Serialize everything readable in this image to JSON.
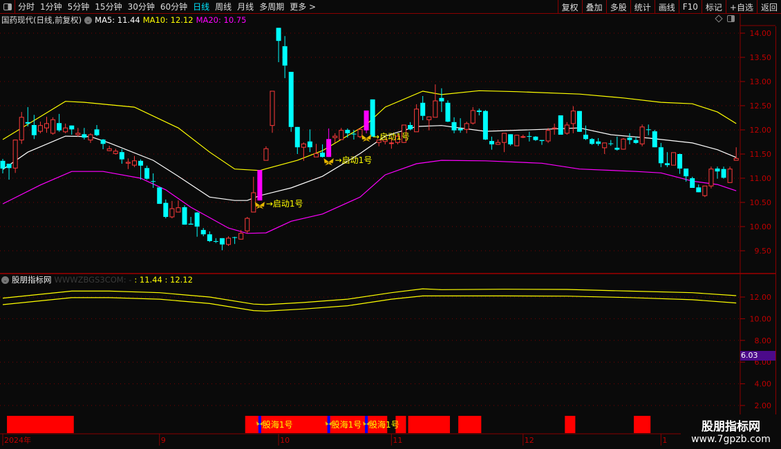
{
  "toolbar": {
    "periods": [
      "分时",
      "1分钟",
      "5分钟",
      "15分钟",
      "30分钟",
      "60分钟",
      "日线",
      "周线",
      "月线",
      "多周期",
      "更多 >"
    ],
    "active_period": "日线",
    "buttons": [
      "复权",
      "叠加",
      "多股",
      "统计",
      "画线",
      "F10",
      "标记",
      "+自选",
      "返回"
    ]
  },
  "info": {
    "title": "国药现代(日线,前复权)",
    "ma5": "MA5: 11.44",
    "ma10": "MA10: 12.12",
    "ma20": "MA20: 10.75"
  },
  "sub": {
    "title": "股朋指标网",
    "source": "WWWZBGS3COM: -",
    "values": " : 11.44 : 12.12",
    "cursor_value": "6.03"
  },
  "watermark": {
    "name": "股朋指标网",
    "url": "www.7gpzb.com"
  },
  "colors": {
    "up": "#ff3b3b",
    "down": "#00ffff",
    "signal": "#ff00ff",
    "upper": "#ffff00",
    "mid": "#ffffff",
    "lower": "#ff00ff",
    "grid": "#7a0000"
  },
  "chart_data": {
    "type": "candlestick",
    "main": {
      "ylim": [
        9.3,
        14.2
      ],
      "yticks": [
        "14.00",
        "13.50",
        "13.00",
        "12.50",
        "12.00",
        "11.50",
        "11.00",
        "10.50",
        "10.00",
        "9.50"
      ],
      "candles": [
        [
          11.36,
          11.4,
          11.1,
          11.2
        ],
        [
          11.3,
          11.3,
          10.97,
          11.21
        ],
        [
          11.21,
          11.8,
          11.11,
          11.79
        ],
        [
          11.79,
          12.37,
          11.71,
          12.26
        ],
        [
          12.16,
          12.47,
          12.07,
          12.13
        ],
        [
          12.1,
          12.31,
          11.81,
          11.89
        ],
        [
          11.97,
          12.17,
          11.93,
          12.09
        ],
        [
          12.04,
          12.27,
          11.94,
          12.13
        ],
        [
          11.93,
          12.26,
          11.9,
          12.21
        ],
        [
          12.14,
          12.33,
          11.96,
          11.99
        ],
        [
          11.96,
          12.13,
          11.93,
          12.04
        ],
        [
          12.09,
          12.09,
          11.9,
          12.01
        ],
        [
          11.9,
          12.04,
          11.86,
          11.93
        ],
        [
          11.91,
          12.04,
          11.8,
          11.84
        ],
        [
          11.79,
          11.93,
          11.73,
          11.9
        ],
        [
          12.01,
          12.1,
          11.87,
          11.89
        ],
        [
          11.8,
          11.81,
          11.6,
          11.71
        ],
        [
          11.57,
          11.67,
          11.56,
          11.61
        ],
        [
          11.51,
          11.61,
          11.49,
          11.56
        ],
        [
          11.54,
          11.6,
          11.3,
          11.39
        ],
        [
          11.31,
          11.41,
          11.19,
          11.33
        ],
        [
          11.27,
          11.46,
          11.23,
          11.36
        ],
        [
          11.36,
          11.39,
          10.97,
          11.26
        ],
        [
          11.21,
          11.26,
          10.97,
          10.99
        ],
        [
          10.94,
          11.1,
          10.8,
          10.93
        ],
        [
          10.81,
          10.81,
          10.47,
          10.47
        ],
        [
          10.49,
          10.56,
          10.17,
          10.2
        ],
        [
          10.2,
          10.53,
          10.17,
          10.37
        ],
        [
          10.3,
          10.54,
          10.3,
          10.39
        ],
        [
          10.4,
          10.44,
          10.04,
          10.04
        ],
        [
          10.06,
          10.2,
          10.04,
          10.04
        ],
        [
          10.29,
          10.3,
          9.79,
          10.0
        ],
        [
          9.93,
          9.97,
          9.8,
          9.84
        ],
        [
          9.84,
          9.9,
          9.68,
          9.7
        ],
        [
          9.7,
          9.76,
          9.66,
          9.69
        ],
        [
          9.76,
          9.76,
          9.51,
          9.63
        ],
        [
          9.63,
          9.8,
          9.6,
          9.76
        ],
        [
          9.78,
          9.79,
          9.64,
          9.77
        ],
        [
          9.74,
          9.93,
          9.73,
          9.86
        ],
        [
          9.91,
          10.2,
          9.86,
          10.17
        ],
        [
          10.3,
          11.03,
          10.3,
          10.7
        ],
        [
          10.54,
          11.17,
          10.54,
          11.17
        ],
        [
          11.37,
          11.66,
          11.37,
          11.61
        ],
        [
          12.09,
          12.8,
          11.94,
          12.8
        ],
        [
          14.11,
          14.11,
          13.4,
          13.84
        ],
        [
          13.73,
          13.94,
          13.07,
          13.33
        ],
        [
          13.2,
          13.2,
          11.96,
          12.06
        ],
        [
          12.06,
          12.06,
          11.5,
          11.64
        ],
        [
          11.64,
          11.74,
          11.36,
          11.71
        ],
        [
          11.76,
          12.01,
          11.54,
          11.64
        ],
        [
          11.44,
          11.71,
          11.44,
          11.51
        ],
        [
          11.53,
          11.7,
          11.43,
          11.44
        ],
        [
          11.44,
          12.03,
          11.44,
          11.81
        ],
        [
          11.84,
          11.93,
          11.73,
          11.87
        ],
        [
          11.8,
          12.04,
          11.8,
          11.99
        ],
        [
          12.0,
          12.03,
          11.84,
          11.93
        ],
        [
          11.92,
          12.0,
          11.8,
          11.91
        ],
        [
          11.86,
          12.04,
          11.83,
          12.01
        ],
        [
          11.99,
          12.4,
          11.93,
          12.4
        ],
        [
          12.63,
          12.63,
          11.86,
          11.86
        ],
        [
          11.74,
          11.79,
          11.66,
          11.79
        ],
        [
          11.76,
          11.83,
          11.7,
          11.8
        ],
        [
          11.73,
          11.87,
          11.61,
          11.73
        ],
        [
          11.74,
          11.9,
          11.7,
          11.87
        ],
        [
          11.74,
          12.1,
          11.73,
          12.1
        ],
        [
          12.1,
          12.16,
          11.99,
          12.01
        ],
        [
          11.96,
          12.53,
          11.96,
          12.43
        ],
        [
          12.56,
          12.7,
          12.2,
          12.29
        ],
        [
          12.21,
          12.27,
          11.99,
          12.27
        ],
        [
          12.26,
          12.94,
          12.26,
          12.6
        ],
        [
          12.66,
          12.86,
          12.37,
          12.59
        ],
        [
          12.56,
          12.61,
          12.16,
          12.17
        ],
        [
          12.16,
          12.26,
          11.93,
          11.99
        ],
        [
          12.03,
          12.24,
          11.94,
          11.99
        ],
        [
          12.01,
          12.17,
          11.93,
          12.13
        ],
        [
          12.14,
          12.47,
          12.11,
          12.4
        ],
        [
          12.4,
          12.44,
          12.3,
          12.37
        ],
        [
          12.39,
          12.41,
          11.79,
          11.8
        ],
        [
          11.77,
          11.86,
          11.59,
          11.7
        ],
        [
          11.7,
          11.8,
          11.69,
          11.74
        ],
        [
          11.74,
          11.93,
          11.54,
          11.93
        ],
        [
          11.91,
          11.91,
          11.67,
          11.7
        ],
        [
          11.67,
          11.9,
          11.67,
          11.89
        ],
        [
          11.86,
          11.9,
          11.83,
          11.86
        ],
        [
          11.87,
          11.96,
          11.76,
          11.86
        ],
        [
          11.86,
          11.87,
          11.77,
          11.79
        ],
        [
          11.79,
          11.79,
          11.69,
          11.77
        ],
        [
          11.77,
          12.04,
          11.73,
          11.99
        ],
        [
          12.04,
          12.13,
          11.9,
          12.04
        ],
        [
          12.3,
          12.3,
          11.9,
          11.9
        ],
        [
          11.93,
          12.16,
          11.9,
          12.1
        ],
        [
          12.13,
          12.49,
          11.93,
          12.39
        ],
        [
          12.39,
          12.39,
          11.96,
          11.96
        ],
        [
          11.9,
          12.09,
          11.79,
          11.81
        ],
        [
          11.81,
          11.83,
          11.69,
          11.71
        ],
        [
          11.76,
          11.83,
          11.67,
          11.71
        ],
        [
          11.63,
          11.73,
          11.5,
          11.73
        ],
        [
          11.72,
          11.79,
          11.67,
          11.71
        ],
        [
          11.63,
          11.86,
          11.57,
          11.59
        ],
        [
          11.6,
          11.83,
          11.59,
          11.81
        ],
        [
          11.84,
          11.93,
          11.7,
          11.79
        ],
        [
          11.79,
          11.86,
          11.71,
          11.73
        ],
        [
          11.71,
          12.11,
          11.66,
          12.06
        ],
        [
          12.01,
          12.11,
          11.89,
          12.0
        ],
        [
          11.97,
          12.0,
          11.64,
          11.64
        ],
        [
          11.64,
          11.73,
          11.23,
          11.31
        ],
        [
          11.31,
          11.54,
          11.23,
          11.27
        ],
        [
          11.27,
          11.53,
          11.27,
          11.53
        ],
        [
          11.5,
          11.51,
          11.09,
          11.2
        ],
        [
          11.2,
          11.2,
          10.93,
          11.04
        ],
        [
          11.0,
          11.03,
          10.8,
          10.8
        ],
        [
          10.81,
          10.87,
          10.71,
          10.71
        ],
        [
          10.64,
          10.84,
          10.61,
          10.84
        ],
        [
          10.84,
          11.24,
          10.79,
          11.19
        ],
        [
          11.2,
          11.24,
          10.99,
          11.14
        ],
        [
          11.19,
          11.24,
          10.99,
          11.01
        ],
        [
          10.91,
          11.24,
          10.91,
          11.19
        ],
        [
          11.37,
          11.64,
          11.37,
          11.41
        ]
      ],
      "signal_candles": [
        41,
        52,
        58
      ],
      "signal_label": "→启动1号",
      "bands": {
        "upper": [
          [
            0,
            11.8
          ],
          [
            10,
            12.59
          ],
          [
            13,
            12.57
          ],
          [
            21,
            12.47
          ],
          [
            28,
            12.04
          ],
          [
            33,
            11.54
          ],
          [
            37,
            11.19
          ],
          [
            41,
            11.16
          ],
          [
            47,
            11.37
          ],
          [
            51,
            11.57
          ],
          [
            58,
            12.11
          ],
          [
            61,
            12.47
          ],
          [
            67,
            12.8
          ],
          [
            70,
            12.73
          ],
          [
            76,
            12.81
          ],
          [
            82,
            12.79
          ],
          [
            92,
            12.74
          ],
          [
            99,
            12.66
          ],
          [
            105,
            12.57
          ],
          [
            110,
            12.54
          ],
          [
            114,
            12.37
          ],
          [
            117,
            12.13
          ]
        ],
        "mid": [
          [
            0,
            11.18
          ],
          [
            4,
            11.54
          ],
          [
            10,
            11.87
          ],
          [
            14,
            11.86
          ],
          [
            17,
            11.73
          ],
          [
            24,
            11.37
          ],
          [
            28,
            11.04
          ],
          [
            33,
            10.61
          ],
          [
            37,
            10.54
          ],
          [
            39,
            10.54
          ],
          [
            41,
            10.64
          ],
          [
            46,
            10.8
          ],
          [
            51,
            11.04
          ],
          [
            57,
            11.51
          ],
          [
            61,
            11.87
          ],
          [
            66,
            12.07
          ],
          [
            70,
            12.09
          ],
          [
            77,
            11.97
          ],
          [
            86,
            12.01
          ],
          [
            92,
            12.04
          ],
          [
            97,
            11.9
          ],
          [
            103,
            11.83
          ],
          [
            110,
            11.73
          ],
          [
            114,
            11.59
          ],
          [
            117,
            11.43
          ]
        ],
        "lower": [
          [
            0,
            10.47
          ],
          [
            6,
            10.86
          ],
          [
            11,
            11.14
          ],
          [
            16,
            11.14
          ],
          [
            22,
            11.0
          ],
          [
            26,
            10.76
          ],
          [
            30,
            10.4
          ],
          [
            36,
            9.97
          ],
          [
            39,
            9.86
          ],
          [
            42,
            9.87
          ],
          [
            46,
            10.11
          ],
          [
            51,
            10.26
          ],
          [
            57,
            10.61
          ],
          [
            61,
            11.07
          ],
          [
            66,
            11.3
          ],
          [
            70,
            11.37
          ],
          [
            77,
            11.36
          ],
          [
            86,
            11.31
          ],
          [
            92,
            11.19
          ],
          [
            101,
            11.14
          ],
          [
            105,
            11.11
          ],
          [
            110,
            10.94
          ],
          [
            114,
            10.87
          ],
          [
            117,
            10.74
          ]
        ]
      }
    },
    "sub": {
      "yticks": [
        "12.00",
        "10.00",
        "8.00",
        "6.00",
        "4.00",
        "2.00"
      ],
      "upper": [
        [
          0,
          11.9
        ],
        [
          11,
          12.55
        ],
        [
          17,
          12.55
        ],
        [
          25,
          12.4
        ],
        [
          33,
          12.0
        ],
        [
          40,
          11.35
        ],
        [
          42,
          11.3
        ],
        [
          48,
          11.5
        ],
        [
          55,
          11.8
        ],
        [
          62,
          12.4
        ],
        [
          67,
          12.76
        ],
        [
          70,
          12.68
        ],
        [
          80,
          12.72
        ],
        [
          90,
          12.7
        ],
        [
          100,
          12.55
        ],
        [
          110,
          12.4
        ],
        [
          117,
          12.13
        ]
      ],
      "lower": [
        [
          0,
          11.3
        ],
        [
          11,
          11.94
        ],
        [
          17,
          11.94
        ],
        [
          25,
          11.8
        ],
        [
          33,
          11.4
        ],
        [
          40,
          10.75
        ],
        [
          42,
          10.7
        ],
        [
          48,
          10.9
        ],
        [
          55,
          11.2
        ],
        [
          62,
          11.8
        ],
        [
          67,
          12.1
        ],
        [
          80,
          12.1
        ],
        [
          90,
          12.08
        ],
        [
          100,
          11.95
        ],
        [
          110,
          11.75
        ],
        [
          117,
          11.45
        ]
      ]
    },
    "signal_bars": {
      "ranges": [
        [
          1,
          11
        ],
        [
          39,
          61
        ],
        [
          63,
          64
        ],
        [
          65,
          71
        ],
        [
          73,
          76
        ],
        [
          90,
          91
        ],
        [
          101,
          103
        ]
      ],
      "markers": [
        41,
        52,
        58
      ],
      "label": "股海1号"
    },
    "xaxis": {
      "labels": [
        {
          "i": 0,
          "text": "2024年"
        },
        {
          "i": 25,
          "text": "9"
        },
        {
          "i": 44,
          "text": "10"
        },
        {
          "i": 62,
          "text": "11"
        },
        {
          "i": 83,
          "text": "12"
        },
        {
          "i": 105,
          "text": "1"
        }
      ]
    }
  }
}
